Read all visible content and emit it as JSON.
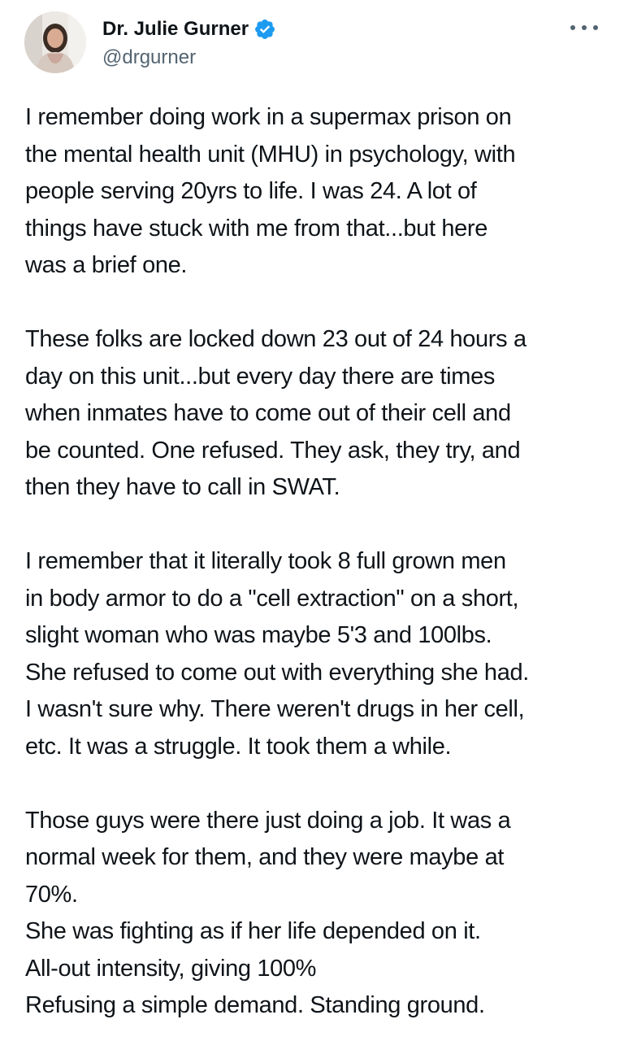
{
  "author": {
    "display_name": "Dr. Julie Gurner",
    "handle": "@drgurner",
    "verified": true,
    "avatar_icon": "profile-photo",
    "verified_icon": "verified-badge-icon",
    "verified_color": "#1d9bf0"
  },
  "menu": {
    "icon": "more-options-icon"
  },
  "tweet": {
    "paragraphs": [
      "I remember doing work in a supermax prison on\nthe mental health unit (MHU) in psychology, with\npeople serving 20yrs to life. I was 24. A lot of\nthings have stuck with me from that...but here\nwas a brief one.",
      "These folks are locked down 23 out of 24 hours a\nday on this unit...but every day there are times\nwhen inmates have to come out of their cell and\nbe counted. One refused. They ask, they try, and\nthen they have to call in SWAT.",
      "I remember that it literally took 8 full grown men\nin body armor to do a \"cell extraction\" on a short,\nslight woman who was maybe 5'3 and 100lbs.\nShe refused to come out with everything she had.\nI wasn't sure why. There weren't drugs in her cell,\netc. It was a struggle. It took them a while.",
      "Those guys were there just doing a job. It was a\nnormal week for them, and they were maybe at\n70%.\nShe was fighting as if her life depended on it.\nAll-out intensity, giving 100%\nRefusing a simple demand. Standing ground."
    ]
  }
}
